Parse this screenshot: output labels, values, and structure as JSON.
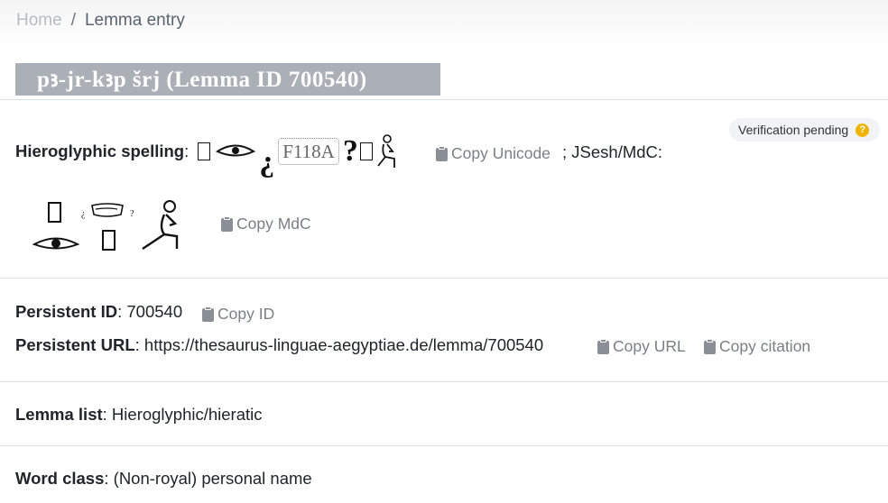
{
  "breadcrumb": {
    "home": "Home",
    "separator": "/",
    "current": "Lemma entry"
  },
  "title": "pꜣ-jr-kꜣp šrj   (Lemma ID 700540)",
  "verification_badge": "Verification pending",
  "spelling": {
    "label": "Hieroglyphic spelling",
    "colon": ":",
    "missing_sign": "F118A",
    "copy_unicode": "Copy Unicode",
    "jsesh_label": "; JSesh/MdC:",
    "copy_mdc": "Copy MdC"
  },
  "persistent_id": {
    "label": "Persistent ID",
    "value": ": 700540",
    "copy": "Copy ID"
  },
  "persistent_url": {
    "label": "Persistent URL",
    "value": ": https://thesaurus-linguae-aegyptiae.de/lemma/700540",
    "copy_url": "Copy URL",
    "copy_citation": "Copy citation"
  },
  "lemma_list": {
    "label": "Lemma list",
    "value": ": Hieroglyphic/hieratic"
  },
  "word_class": {
    "label": "Word class",
    "value": ": (Non-royal) personal name"
  },
  "colors": {
    "title_bg": "#aab0b6",
    "badge_icon": "#f0b400",
    "copy_text": "#7a7f85"
  }
}
